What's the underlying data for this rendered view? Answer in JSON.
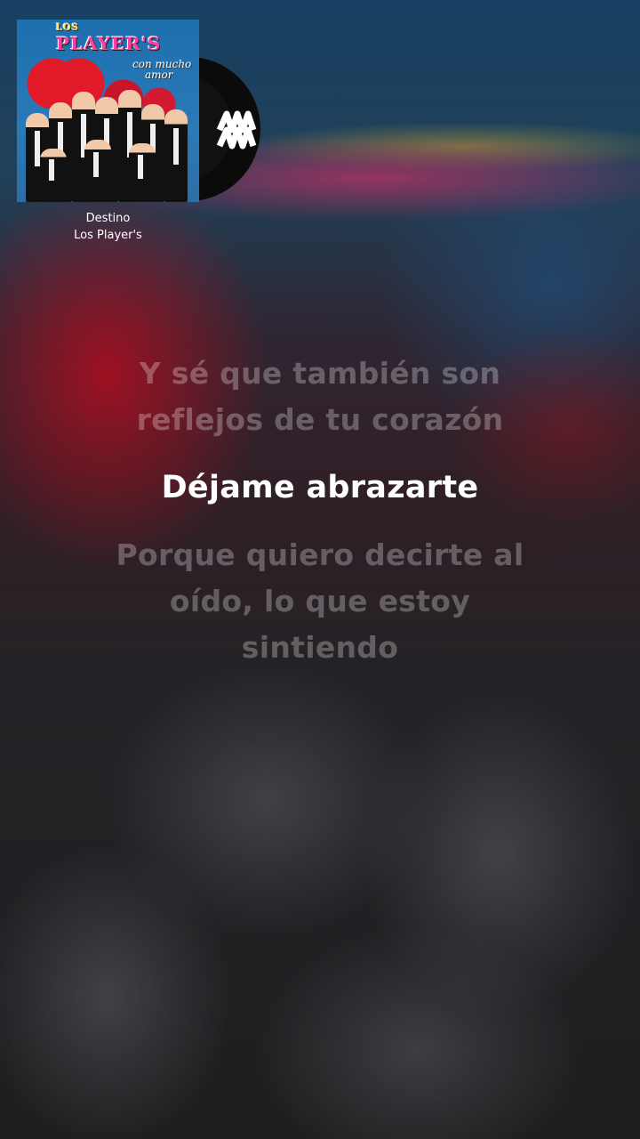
{
  "now_playing": {
    "title": "Destino",
    "artist": "Los Player's",
    "cover": {
      "logo_top": "LOS",
      "logo_main": "PLAYER'S",
      "tagline_line1": "con mucho",
      "tagline_line2": "amor"
    },
    "service_logo_icon": "music-service-logo-icon"
  },
  "lyrics": {
    "previous": [
      "Y sé que también son",
      "reflejos de tu corazón"
    ],
    "current": "Déjame abrazarte",
    "next": [
      "Porque quiero decirte al",
      "oído, lo que estoy",
      "sintiendo"
    ]
  },
  "colors": {
    "active_lyric": "#ffffff",
    "inactive_lyric": "rgba(255,255,255,0.28)"
  }
}
